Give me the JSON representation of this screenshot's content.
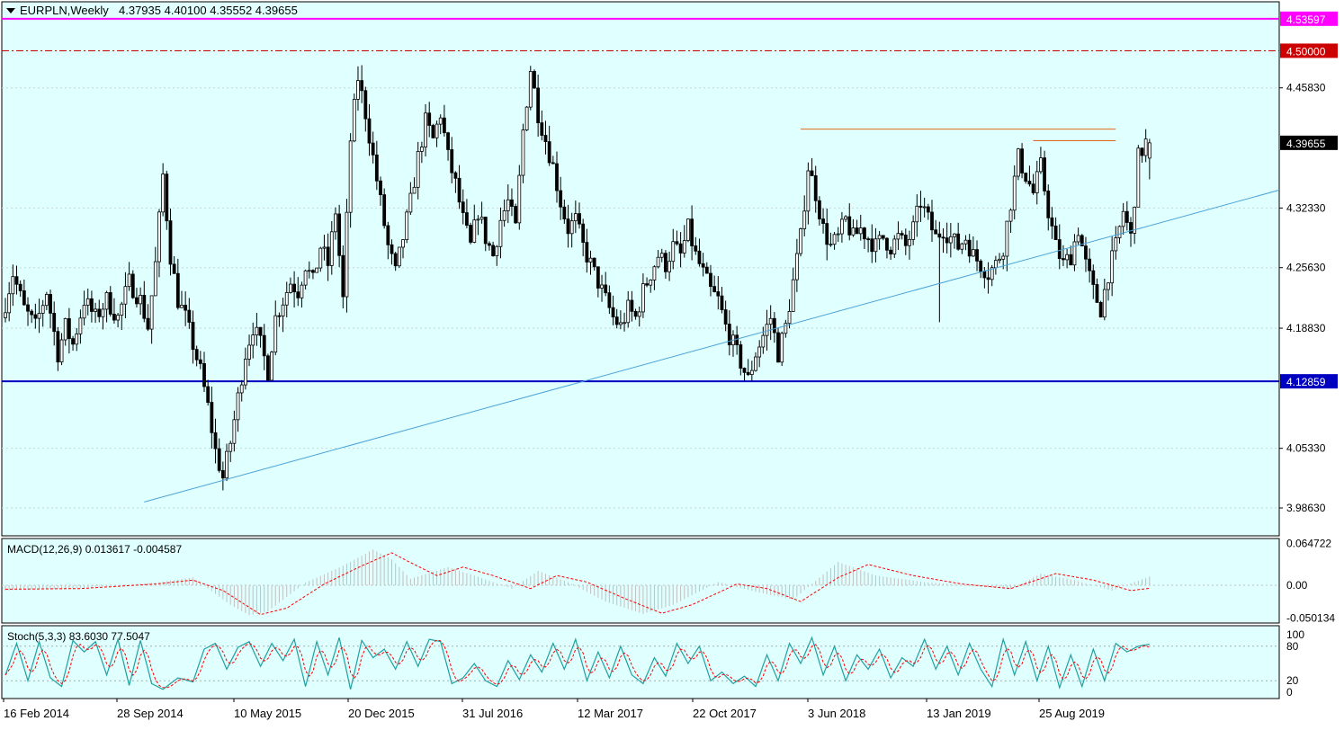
{
  "header": {
    "symbol": "EURPLN,Weekly",
    "ohlc": "4.37935 4.40100 4.35552 4.39655"
  },
  "colors": {
    "background": "#e0ffff",
    "candle": "#000000",
    "line_magenta": "#ff00ff",
    "line_red": "#cc0000",
    "line_blue": "#0000c0",
    "trendline": "#4aa3d8",
    "resistance": "#e06a1a",
    "macd_hist": "#c0c0c0",
    "signal": "#ff0000",
    "stoch_main": "#20a0a0"
  },
  "chart_data": [
    {
      "type": "candlestick",
      "title": "EURPLN,Weekly",
      "x_tick_labels": [
        "16 Feb 2014",
        "28 Sep 2014",
        "10 May 2015",
        "20 Dec 2015",
        "31 Jul 2016",
        "12 Mar 2017",
        "22 Oct 2017",
        "3 Jun 2018",
        "13 Jan 2019",
        "25 Aug 2019"
      ],
      "y_tick_labels": [
        "4.45830",
        "4.32330",
        "4.25630",
        "4.18830",
        "4.05330",
        "3.98630"
      ],
      "ylim": [
        3.955,
        4.555
      ],
      "last": {
        "open": 4.37935,
        "high": 4.401,
        "low": 4.35552,
        "close": 4.39655
      },
      "horizontal_levels": [
        {
          "label": "4.53597",
          "value": 4.53597,
          "style": "solid",
          "color": "#ff00ff"
        },
        {
          "label": "4.50000",
          "value": 4.5,
          "style": "dashdot",
          "color": "#cc0000"
        },
        {
          "label": "4.39655",
          "value": 4.39655,
          "style": "price",
          "color": "#000000"
        },
        {
          "label": "4.12859",
          "value": 4.12859,
          "style": "solid",
          "color": "#0000c0"
        }
      ],
      "resistance_lines": [
        {
          "from_week": 212,
          "to_week": 296,
          "value": 4.412
        },
        {
          "from_week": 274,
          "to_week": 296,
          "value": 4.399
        }
      ],
      "trendline": {
        "from": {
          "week": 37,
          "value": 3.993
        },
        "to": {
          "week": 296,
          "value": 4.293
        }
      },
      "price_path": [
        [
          0,
          4.2
        ],
        [
          3,
          4.25
        ],
        [
          6,
          4.21
        ],
        [
          9,
          4.19
        ],
        [
          12,
          4.23
        ],
        [
          15,
          4.16
        ],
        [
          17,
          4.19
        ],
        [
          19,
          4.17
        ],
        [
          22,
          4.22
        ],
        [
          25,
          4.2
        ],
        [
          28,
          4.22
        ],
        [
          31,
          4.2
        ],
        [
          34,
          4.24
        ],
        [
          37,
          4.22
        ],
        [
          39,
          4.19
        ],
        [
          41,
          4.26
        ],
        [
          43,
          4.36
        ],
        [
          45,
          4.27
        ],
        [
          47,
          4.22
        ],
        [
          49,
          4.2
        ],
        [
          51,
          4.17
        ],
        [
          53,
          4.14
        ],
        [
          55,
          4.1
        ],
        [
          57,
          4.05
        ],
        [
          59,
          4.02
        ],
        [
          61,
          4.06
        ],
        [
          63,
          4.11
        ],
        [
          65,
          4.16
        ],
        [
          67,
          4.19
        ],
        [
          69,
          4.17
        ],
        [
          71,
          4.14
        ],
        [
          73,
          4.2
        ],
        [
          75,
          4.22
        ],
        [
          77,
          4.24
        ],
        [
          79,
          4.23
        ],
        [
          81,
          4.26
        ],
        [
          83,
          4.24
        ],
        [
          85,
          4.28
        ],
        [
          87,
          4.26
        ],
        [
          89,
          4.32
        ],
        [
          91,
          4.22
        ],
        [
          93,
          4.4
        ],
        [
          95,
          4.47
        ],
        [
          97,
          4.43
        ],
        [
          99,
          4.38
        ],
        [
          101,
          4.33
        ],
        [
          103,
          4.28
        ],
        [
          105,
          4.25
        ],
        [
          107,
          4.29
        ],
        [
          109,
          4.33
        ],
        [
          111,
          4.38
        ],
        [
          113,
          4.42
        ],
        [
          115,
          4.4
        ],
        [
          117,
          4.43
        ],
        [
          119,
          4.38
        ],
        [
          121,
          4.35
        ],
        [
          123,
          4.31
        ],
        [
          125,
          4.28
        ],
        [
          127,
          4.32
        ],
        [
          129,
          4.29
        ],
        [
          131,
          4.27
        ],
        [
          133,
          4.31
        ],
        [
          135,
          4.33
        ],
        [
          137,
          4.3
        ],
        [
          139,
          4.41
        ],
        [
          141,
          4.48
        ],
        [
          143,
          4.43
        ],
        [
          145,
          4.4
        ],
        [
          147,
          4.37
        ],
        [
          149,
          4.33
        ],
        [
          151,
          4.3
        ],
        [
          153,
          4.31
        ],
        [
          155,
          4.28
        ],
        [
          157,
          4.26
        ],
        [
          159,
          4.24
        ],
        [
          161,
          4.22
        ],
        [
          163,
          4.2
        ],
        [
          165,
          4.19
        ],
        [
          167,
          4.21
        ],
        [
          169,
          4.2
        ],
        [
          171,
          4.23
        ],
        [
          173,
          4.25
        ],
        [
          175,
          4.27
        ],
        [
          177,
          4.26
        ],
        [
          179,
          4.28
        ],
        [
          181,
          4.27
        ],
        [
          183,
          4.3
        ],
        [
          185,
          4.27
        ],
        [
          187,
          4.25
        ],
        [
          189,
          4.23
        ],
        [
          191,
          4.22
        ],
        [
          193,
          4.19
        ],
        [
          195,
          4.17
        ],
        [
          197,
          4.15
        ],
        [
          199,
          4.13
        ],
        [
          201,
          4.16
        ],
        [
          203,
          4.18
        ],
        [
          205,
          4.2
        ],
        [
          207,
          4.16
        ],
        [
          209,
          4.19
        ],
        [
          211,
          4.24
        ],
        [
          213,
          4.29
        ],
        [
          215,
          4.37
        ],
        [
          217,
          4.34
        ],
        [
          219,
          4.3
        ],
        [
          221,
          4.28
        ],
        [
          223,
          4.29
        ],
        [
          225,
          4.31
        ],
        [
          227,
          4.29
        ],
        [
          229,
          4.3
        ],
        [
          231,
          4.29
        ],
        [
          233,
          4.28
        ],
        [
          235,
          4.29
        ],
        [
          237,
          4.28
        ],
        [
          239,
          4.29
        ],
        [
          241,
          4.28
        ],
        [
          243,
          4.3
        ],
        [
          245,
          4.33
        ],
        [
          247,
          4.31
        ],
        [
          249,
          4.29
        ],
        [
          251,
          4.3
        ],
        [
          253,
          4.29
        ],
        [
          255,
          4.28
        ],
        [
          257,
          4.29
        ],
        [
          259,
          4.27
        ],
        [
          261,
          4.26
        ],
        [
          263,
          4.25
        ],
        [
          265,
          4.26
        ],
        [
          267,
          4.28
        ],
        [
          269,
          4.33
        ],
        [
          271,
          4.38
        ],
        [
          273,
          4.36
        ],
        [
          275,
          4.34
        ],
        [
          277,
          4.37
        ],
        [
          279,
          4.32
        ],
        [
          281,
          4.28
        ],
        [
          283,
          4.26
        ],
        [
          285,
          4.27
        ],
        [
          287,
          4.3
        ],
        [
          289,
          4.26
        ],
        [
          291,
          4.23
        ],
        [
          293,
          4.21
        ],
        [
          295,
          4.25
        ],
        [
          297,
          4.28
        ],
        [
          299,
          4.32
        ],
        [
          301,
          4.29
        ],
        [
          303,
          4.38
        ],
        [
          305,
          4.397
        ]
      ]
    },
    {
      "type": "bar",
      "title": "MACD(12,26,9) 0.013617 -0.004587",
      "y_tick_labels": [
        "0.064722",
        "0.00",
        "-0.050134"
      ],
      "ylim": [
        -0.058,
        0.072
      ],
      "macd_path": [
        [
          0,
          -0.008
        ],
        [
          20,
          -0.004
        ],
        [
          40,
          0.004
        ],
        [
          50,
          0.012
        ],
        [
          60,
          -0.03
        ],
        [
          65,
          -0.046
        ],
        [
          70,
          -0.04
        ],
        [
          80,
          0.004
        ],
        [
          90,
          0.03
        ],
        [
          98,
          0.055
        ],
        [
          103,
          0.04
        ],
        [
          108,
          0.01
        ],
        [
          118,
          0.028
        ],
        [
          125,
          0.015
        ],
        [
          135,
          -0.005
        ],
        [
          142,
          0.022
        ],
        [
          150,
          0.005
        ],
        [
          160,
          -0.025
        ],
        [
          170,
          -0.044
        ],
        [
          178,
          -0.03
        ],
        [
          190,
          0.005
        ],
        [
          200,
          -0.01
        ],
        [
          210,
          -0.022
        ],
        [
          222,
          0.036
        ],
        [
          232,
          0.015
        ],
        [
          245,
          0.005
        ],
        [
          260,
          -0.002
        ],
        [
          268,
          -0.006
        ],
        [
          276,
          0.018
        ],
        [
          285,
          0.008
        ],
        [
          295,
          -0.008
        ],
        [
          305,
          0.013617
        ]
      ],
      "signal_path": [
        [
          0,
          -0.006
        ],
        [
          20,
          -0.005
        ],
        [
          40,
          0.002
        ],
        [
          50,
          0.008
        ],
        [
          58,
          -0.008
        ],
        [
          68,
          -0.045
        ],
        [
          75,
          -0.035
        ],
        [
          85,
          0.002
        ],
        [
          95,
          0.03
        ],
        [
          103,
          0.05
        ],
        [
          108,
          0.035
        ],
        [
          115,
          0.015
        ],
        [
          122,
          0.028
        ],
        [
          130,
          0.015
        ],
        [
          140,
          -0.005
        ],
        [
          147,
          0.015
        ],
        [
          155,
          0.005
        ],
        [
          165,
          -0.02
        ],
        [
          175,
          -0.043
        ],
        [
          183,
          -0.03
        ],
        [
          195,
          0.002
        ],
        [
          203,
          -0.005
        ],
        [
          212,
          -0.025
        ],
        [
          222,
          0.012
        ],
        [
          230,
          0.032
        ],
        [
          242,
          0.015
        ],
        [
          255,
          0.002
        ],
        [
          268,
          -0.005
        ],
        [
          280,
          0.018
        ],
        [
          290,
          0.008
        ],
        [
          300,
          -0.008
        ],
        [
          305,
          -0.004587
        ]
      ]
    },
    {
      "type": "line",
      "title": "Stoch(5,3,3) 83.6030 77.5047",
      "y_tick_labels": [
        "100",
        "80",
        "20",
        "0"
      ],
      "ylim": [
        0,
        100
      ],
      "levels": [
        80,
        20
      ],
      "main_last": 83.603,
      "signal_last": 77.5047,
      "main_path": [
        [
          0,
          30
        ],
        [
          3,
          85
        ],
        [
          6,
          20
        ],
        [
          9,
          88
        ],
        [
          12,
          25
        ],
        [
          15,
          10
        ],
        [
          18,
          90
        ],
        [
          21,
          70
        ],
        [
          24,
          88
        ],
        [
          27,
          30
        ],
        [
          30,
          92
        ],
        [
          33,
          12
        ],
        [
          36,
          90
        ],
        [
          39,
          15
        ],
        [
          42,
          5
        ],
        [
          46,
          25
        ],
        [
          50,
          18
        ],
        [
          53,
          75
        ],
        [
          56,
          85
        ],
        [
          59,
          40
        ],
        [
          62,
          78
        ],
        [
          65,
          88
        ],
        [
          68,
          45
        ],
        [
          71,
          85
        ],
        [
          74,
          55
        ],
        [
          77,
          92
        ],
        [
          80,
          10
        ],
        [
          83,
          88
        ],
        [
          86,
          30
        ],
        [
          89,
          95
        ],
        [
          92,
          5
        ],
        [
          95,
          90
        ],
        [
          98,
          60
        ],
        [
          101,
          75
        ],
        [
          104,
          40
        ],
        [
          107,
          88
        ],
        [
          110,
          45
        ],
        [
          113,
          92
        ],
        [
          116,
          88
        ],
        [
          119,
          15
        ],
        [
          122,
          25
        ],
        [
          125,
          50
        ],
        [
          128,
          20
        ],
        [
          131,
          10
        ],
        [
          134,
          55
        ],
        [
          137,
          22
        ],
        [
          140,
          65
        ],
        [
          143,
          35
        ],
        [
          146,
          85
        ],
        [
          149,
          40
        ],
        [
          152,
          92
        ],
        [
          155,
          20
        ],
        [
          158,
          70
        ],
        [
          161,
          25
        ],
        [
          164,
          80
        ],
        [
          167,
          30
        ],
        [
          170,
          15
        ],
        [
          173,
          60
        ],
        [
          176,
          28
        ],
        [
          179,
          85
        ],
        [
          182,
          50
        ],
        [
          185,
          80
        ],
        [
          188,
          20
        ],
        [
          191,
          35
        ],
        [
          194,
          15
        ],
        [
          197,
          28
        ],
        [
          200,
          10
        ],
        [
          203,
          65
        ],
        [
          206,
          20
        ],
        [
          209,
          85
        ],
        [
          212,
          50
        ],
        [
          215,
          95
        ],
        [
          218,
          30
        ],
        [
          221,
          80
        ],
        [
          224,
          20
        ],
        [
          227,
          65
        ],
        [
          230,
          40
        ],
        [
          233,
          75
        ],
        [
          236,
          25
        ],
        [
          239,
          60
        ],
        [
          242,
          45
        ],
        [
          245,
          92
        ],
        [
          248,
          40
        ],
        [
          251,
          80
        ],
        [
          254,
          30
        ],
        [
          257,
          85
        ],
        [
          260,
          40
        ],
        [
          263,
          10
        ],
        [
          266,
          92
        ],
        [
          269,
          30
        ],
        [
          272,
          88
        ],
        [
          275,
          20
        ],
        [
          278,
          80
        ],
        [
          281,
          8
        ],
        [
          284,
          65
        ],
        [
          287,
          10
        ],
        [
          290,
          75
        ],
        [
          293,
          20
        ],
        [
          296,
          85
        ],
        [
          299,
          70
        ],
        [
          302,
          80
        ],
        [
          305,
          83.6
        ]
      ]
    }
  ]
}
